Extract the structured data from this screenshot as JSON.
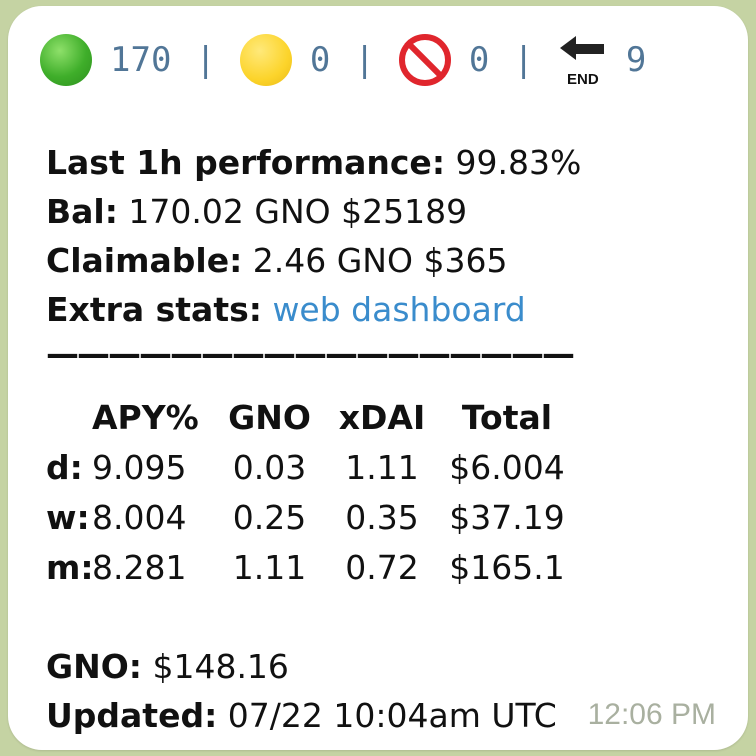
{
  "status": {
    "green_count": "170",
    "yellow_count": "0",
    "blocked_count": "0",
    "end_count": "9",
    "separator": "|",
    "end_icon_label": "END"
  },
  "summary": {
    "performance_label": "Last 1h performance:",
    "performance_value": " 99.83%",
    "bal_label": "Bal:",
    "bal_value": " 170.02 GNO $25189",
    "claimable_label": "Claimable:",
    "claimable_value": " 2.46 GNO $365",
    "extra_label": "Extra stats:",
    "extra_link": "web dashboard"
  },
  "divider": "—————————————————",
  "table": {
    "headers": [
      "",
      "APY%",
      "GNO",
      "xDAI",
      "Total"
    ],
    "rows": [
      {
        "period": "d:",
        "apy": "9.095",
        "gno": "0.03",
        "xdai": "1.11",
        "total": "$6.004"
      },
      {
        "period": "w:",
        "apy": "8.004",
        "gno": "0.25",
        "xdai": "0.35",
        "total": "$37.19"
      },
      {
        "period": "m:",
        "apy": "8.281",
        "gno": "1.11",
        "xdai": "0.72",
        "total": "$165.1"
      }
    ]
  },
  "footer": {
    "gno_label": "GNO:",
    "gno_value": " $148.16",
    "updated_label": "Updated:",
    "updated_value": " 07/22 10:04am UTC"
  },
  "message_time": "12:06 PM"
}
